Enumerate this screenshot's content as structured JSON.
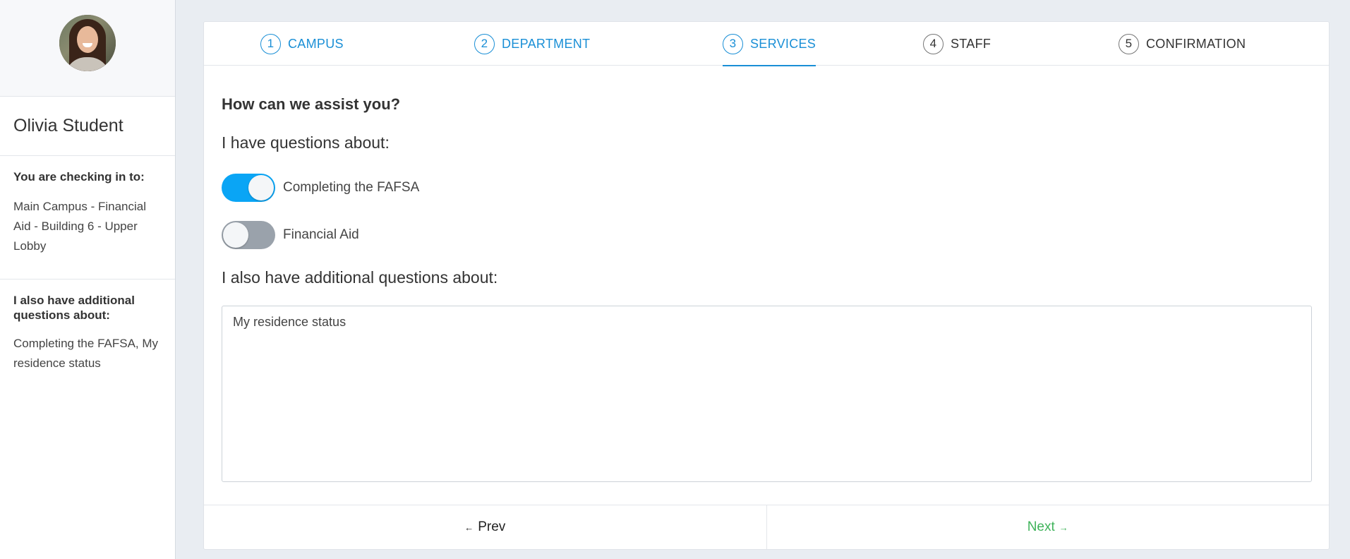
{
  "sidebar": {
    "student_name": "Olivia Student",
    "checkin_heading": "You are checking in to:",
    "checkin_location": "Main Campus - Financial Aid - Building 6 - Upper Lobby",
    "additional_heading": "I also have additional questions about:",
    "additional_text": "Completing the FAFSA, My residence status"
  },
  "steps": [
    {
      "num": "1",
      "label": "CAMPUS",
      "state": "done"
    },
    {
      "num": "2",
      "label": "DEPARTMENT",
      "state": "done"
    },
    {
      "num": "3",
      "label": "SERVICES",
      "state": "active"
    },
    {
      "num": "4",
      "label": "STAFF",
      "state": "pending"
    },
    {
      "num": "5",
      "label": "CONFIRMATION",
      "state": "pending"
    }
  ],
  "form": {
    "title": "How can we assist you?",
    "questions_label": "I have questions about:",
    "toggles": [
      {
        "label": "Completing the FAFSA",
        "on": true
      },
      {
        "label": "Financial Aid",
        "on": false
      }
    ],
    "additional_label": "I also have additional questions about:",
    "additional_value": "My residence status"
  },
  "footer": {
    "prev_label": "Prev",
    "next_label": "Next",
    "prev_arrow": "←",
    "next_arrow": "→"
  },
  "colors": {
    "accent": "#1a8fd6",
    "toggle_on": "#0aa5f5",
    "toggle_off": "#9aa2ab",
    "next": "#3fb35a"
  }
}
